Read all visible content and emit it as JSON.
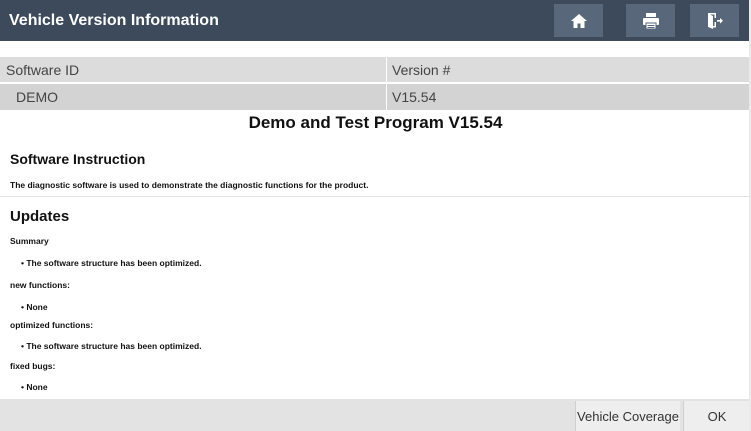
{
  "header": {
    "title": "Vehicle Version Information",
    "icons": [
      "home-icon",
      "print-icon",
      "exit-icon"
    ]
  },
  "table": {
    "headers": [
      "Software ID",
      "Version #"
    ],
    "row": [
      "DEMO",
      "V15.54"
    ]
  },
  "program_title": "Demo and Test Program V15.54",
  "instruction": {
    "heading": "Software Instruction",
    "text": "The diagnostic software is used to demonstrate the diagnostic functions for the product."
  },
  "updates": {
    "heading": "Updates",
    "summary_label": "Summary",
    "summary_item": "• The software structure has been optimized.",
    "new_label": "new functions:",
    "new_item": "• None",
    "optimized_label": "optimized functions:",
    "optimized_item": "• The software structure has been optimized.",
    "fixed_label": "fixed bugs:",
    "fixed_item": "• None"
  },
  "footer": {
    "vehicle_coverage": "Vehicle Coverage",
    "ok": "OK"
  },
  "colors": {
    "titlebar": "#3c4a5c",
    "titlebar_button": "#58677a",
    "row_header": "#dcdcdc",
    "row_data": "#d3d3d3"
  }
}
